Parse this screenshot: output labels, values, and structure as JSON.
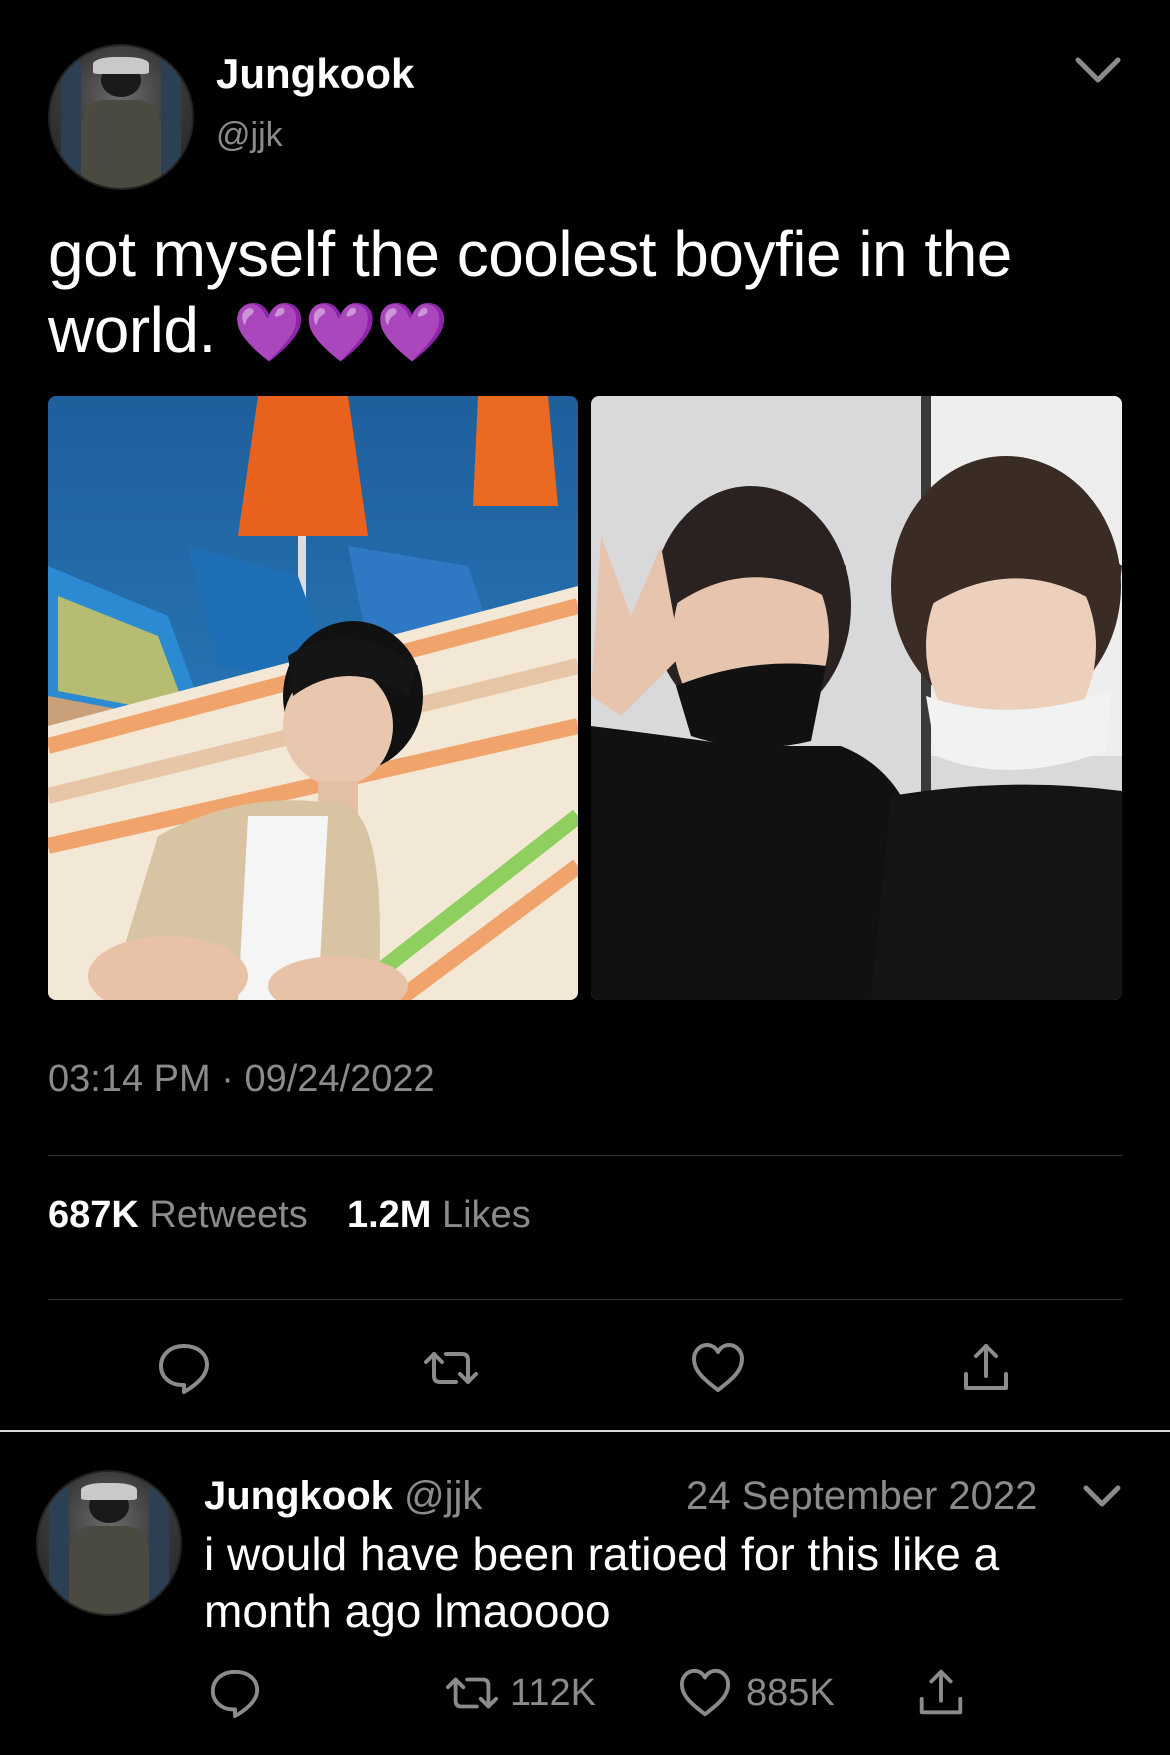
{
  "tweet": {
    "author_name": "Jungkook",
    "author_handle": "@jjk",
    "text": "got myself the coolest boyfie in the world.",
    "emojis": "💜💜💜",
    "time": "03:14 PM",
    "date": "09/24/2022",
    "retweets_count": "687K",
    "retweets_label": "Retweets",
    "likes_count": "1.2M",
    "likes_label": "Likes"
  },
  "reply": {
    "author_name": "Jungkook",
    "author_handle": "@jjk",
    "date": "24 September 2022",
    "text": "i would have been ratioed for this like a month ago lmaoooo",
    "retweets": "112K",
    "likes": "885K"
  },
  "colors": {
    "background": "#000000",
    "text": "#ffffff",
    "muted": "#8b8b8b",
    "divider": "#2f3336",
    "heart": "#9b30ff"
  },
  "icons": [
    "chevron-down-icon",
    "reply-icon",
    "retweet-icon",
    "like-icon",
    "share-icon"
  ]
}
